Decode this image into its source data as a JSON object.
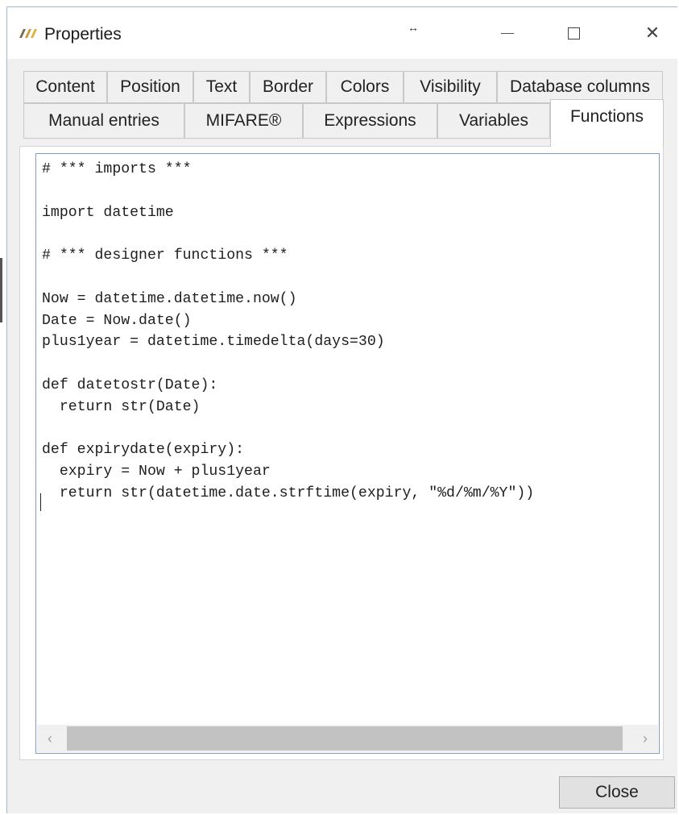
{
  "window": {
    "title": "Properties",
    "resize_glyph": "↔",
    "controls": {
      "minimize_icon": "minimize-icon",
      "maximize_icon": "maximize-icon",
      "close_icon": "close-icon",
      "close_glyph": "✕"
    }
  },
  "tabs": {
    "row1": [
      {
        "label": "Content"
      },
      {
        "label": "Position"
      },
      {
        "label": "Text"
      },
      {
        "label": "Border"
      },
      {
        "label": "Colors"
      },
      {
        "label": "Visibility"
      },
      {
        "label": "Database columns"
      }
    ],
    "row2": [
      {
        "label": "Manual entries"
      },
      {
        "label": "MIFARE®"
      },
      {
        "label": "Expressions"
      },
      {
        "label": "Variables"
      },
      {
        "label": "Functions",
        "active": true
      }
    ]
  },
  "editor": {
    "lines": [
      "# *** imports ***",
      "",
      "import datetime",
      "",
      "# *** designer functions ***",
      "",
      "Now = datetime.datetime.now()",
      "Date = Now.date()",
      "plus1year = datetime.timedelta(days=30)",
      "",
      "def datetostr(Date):",
      "  return str(Date)",
      "",
      "def expirydate(expiry):",
      "  expiry = Now + plus1year",
      "  return str(datetime.date.strftime(expiry, \"%d/%m/%Y\"))"
    ],
    "scrollbar": {
      "left_glyph": "‹",
      "right_glyph": "›"
    }
  },
  "footer": {
    "close_label": "Close"
  },
  "colors": {
    "window_bg": "#f0f0f0",
    "editor_border": "#7a9cc6",
    "tab_border": "#c8c8c8"
  }
}
